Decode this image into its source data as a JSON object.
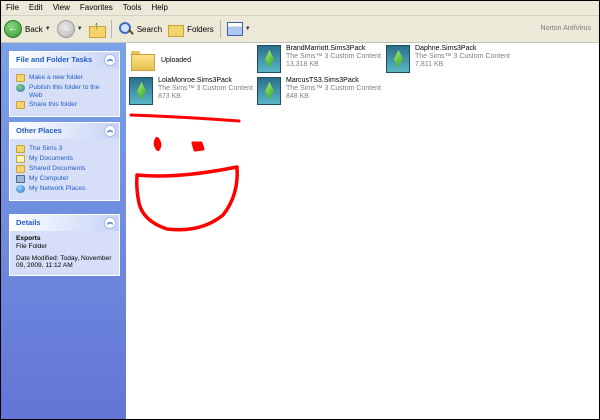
{
  "menu": [
    "File",
    "Edit",
    "View",
    "Favorites",
    "Tools",
    "Help"
  ],
  "toolbar": {
    "back_label": "Back",
    "search_label": "Search",
    "folders_label": "Folders",
    "norton": "Norton AntiVirus"
  },
  "sidebar": {
    "file_tasks": {
      "title": "File and Folder Tasks",
      "items": [
        "Make a new folder",
        "Publish this folder to the Web",
        "Share this folder"
      ]
    },
    "other_places": {
      "title": "Other Places",
      "items": [
        "The Sims 3",
        "My Documents",
        "Shared Documents",
        "My Computer",
        "My Network Places"
      ]
    },
    "details": {
      "title": "Details",
      "name": "Exports",
      "type": "File Folder",
      "modified": "Date Modified: Today, November 09, 2009, 11:12 AM"
    }
  },
  "files": [
    {
      "name": "Uploaded",
      "kind": "folder"
    },
    {
      "name": "BrandMarriott.Sims3Pack",
      "type": "The Sims™ 3 Custom Content",
      "size": "13,318 KB",
      "kind": "sims"
    },
    {
      "name": "Daphne.Sims3Pack",
      "type": "The Sims™ 3 Custom Content",
      "size": "7,811 KB",
      "kind": "sims"
    },
    {
      "name": "LolaMonroe.Sims3Pack",
      "type": "The Sims™ 3 Custom Content",
      "size": "873 KB",
      "kind": "sims"
    },
    {
      "name": "MarcusTS3.Sims3Pack",
      "type": "The Sims™ 3 Custom Content",
      "size": "848 KB",
      "kind": "sims"
    }
  ],
  "colors": {
    "sidebar_gradient_top": "#7ba2e7",
    "sidebar_gradient_bottom": "#6375d6",
    "link_blue": "#215dc6",
    "drawing_red": "#ff0000"
  }
}
